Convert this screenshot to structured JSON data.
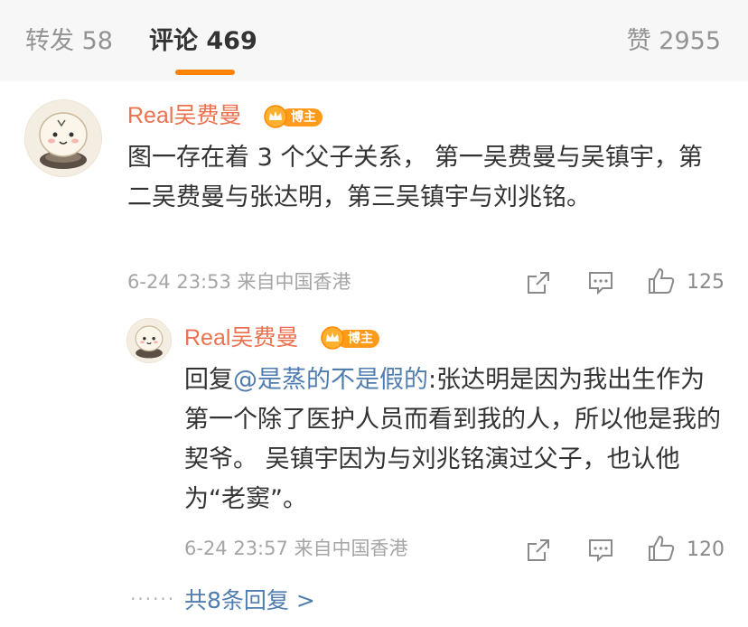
{
  "tabs": {
    "repost": "转发 58",
    "comments": "评论 469",
    "likes": "赞 2955"
  },
  "comment": {
    "username": "Real吴费曼",
    "badge": "博主",
    "text": "图一存在着 3 个父子关系， 第一吴费曼与吴镇宇，第二吴费曼与张达明，第三吴镇宇与刘兆铭。",
    "meta": "6-24 23:53  来自中国香港",
    "likes": "125"
  },
  "reply": {
    "username": "Real吴费曼",
    "badge": "博主",
    "prefix": "回复",
    "mention": "@是蒸的不是假的",
    "text": ":张达明是因为我出生作为第一个除了医护人员而看到我的人，所以他是我的契爷。 吴镇宇因为与刘兆铭演过父子，也认他为“老窦”。",
    "meta": "6-24 23:57  来自中国香港",
    "likes": "120"
  },
  "more_replies": "共8条回复 >",
  "colors": {
    "accent": "#ff8200",
    "username": "#eb7350",
    "link": "#507daf",
    "meta": "#a5a5a5"
  },
  "icons": [
    "share-icon",
    "comment-icon",
    "like-icon",
    "crown-icon",
    "more-dots-icon"
  ]
}
